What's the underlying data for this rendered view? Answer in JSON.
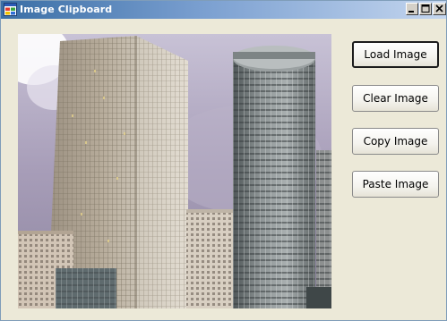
{
  "window": {
    "title": "Image Clipboard",
    "icon": "app-window-icon",
    "controls": [
      "minimize-icon",
      "maximize-icon",
      "close-icon"
    ]
  },
  "picture": {
    "content": "photo of city skyscrapers"
  },
  "buttons": {
    "load": "Load Image",
    "clear": "Clear Image",
    "copy": "Copy Image",
    "paste": "Paste Image"
  },
  "colors": {
    "titlebar_start": "#3a6ea5",
    "titlebar_end": "#c4d6ef",
    "form_background": "#ece9d8"
  }
}
